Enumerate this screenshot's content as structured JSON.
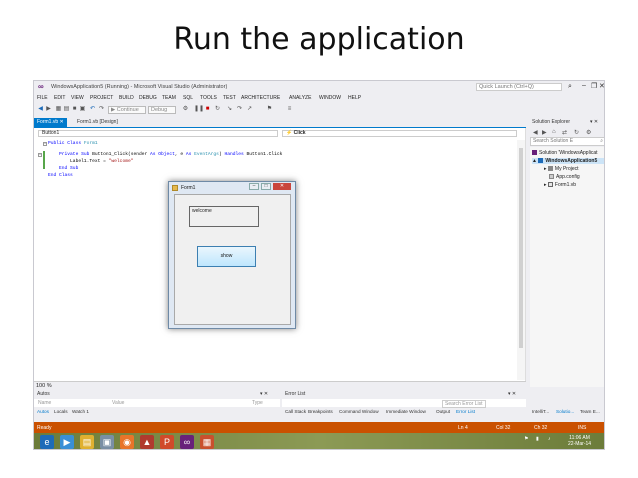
{
  "slide": {
    "title": "Run the application"
  },
  "window": {
    "title": "WindowsApplication5 (Running) - Microsoft Visual Studio (Administrator)",
    "quick_launch_placeholder": "Quick Launch (Ctrl+Q)"
  },
  "menu": [
    "FILE",
    "EDIT",
    "VIEW",
    "PROJECT",
    "BUILD",
    "DEBUG",
    "TEAM",
    "SQL",
    "TOOLS",
    "TEST",
    "ARCHITECTURE",
    "ANALYZE",
    "WINDOW",
    "HELP"
  ],
  "toolbar": {
    "continue_label": "▶ Continue",
    "config": "Debug"
  },
  "tabs": {
    "tab1": "Form1.vb",
    "tab2": "Form1.vb [Design]"
  },
  "editor": {
    "object_combo": "Button1",
    "event_combo": "Click",
    "lines": {
      "l1_kw": "Public Class",
      "l1_name": " Form1",
      "l2_a": "    Private Sub",
      "l2_b": " Button1_Click(sender ",
      "l2_c": "As Object",
      "l2_d": ", e ",
      "l2_e": "As",
      "l2_f": " EventArgs",
      "l2_g": ") ",
      "l2_h": "Handles",
      "l2_i": " Button1.Click",
      "l3_a": "        Label1.Text = ",
      "l3_b": "\"welcome\"",
      "l4": "    End Sub",
      "l5": "End Class"
    },
    "zoom": "100 %"
  },
  "form": {
    "title": "Form1",
    "label_text": "welcome",
    "button_label": "show"
  },
  "panels": {
    "autos_title": "Autos",
    "autos_cols": [
      "Name",
      "Value",
      "Type"
    ],
    "autos_tabs": [
      "Autos",
      "Locals",
      "Watch 1"
    ],
    "errors_title": "Error List",
    "search_placeholder": "Search Error List",
    "error_tabs": [
      "Call Stack",
      "Breakpoints",
      "Command Window",
      "Immediate Window",
      "Output",
      "Error List"
    ]
  },
  "solution": {
    "title": "Solution Explorer",
    "search_placeholder": "Search Solution E",
    "items": [
      "Solution 'WindowsApplicat",
      "WindowsApplication5",
      "My Project",
      "App.config",
      "Form1.vb"
    ],
    "bottom_tabs": [
      "IntelliT...",
      "Solutio...",
      "Team E..."
    ]
  },
  "status": {
    "state": "Ready",
    "ln": "Ln 4",
    "col": "Col 32",
    "ch": "Ch 32",
    "mode": "INS"
  },
  "taskbar": {
    "time": "11:06 AM",
    "date": "22-Mar-14"
  },
  "colors": {
    "accent": "#007acc",
    "status_bar": "#ca5100",
    "vs_purple": "#68217a"
  }
}
